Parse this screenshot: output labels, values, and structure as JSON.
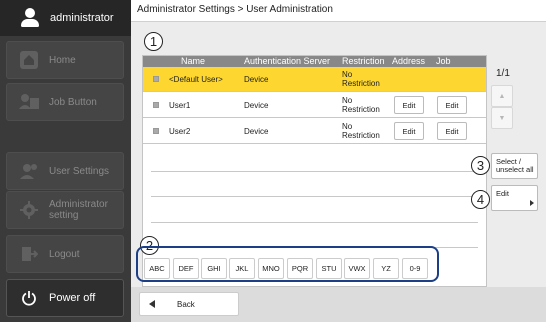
{
  "user": {
    "name": "administrator"
  },
  "sidebar": {
    "items": [
      {
        "label": "Home",
        "icon": "home-icon"
      },
      {
        "label": "Job Button",
        "icon": "job-button-icon"
      },
      {
        "label": "User Settings",
        "icon": "user-settings-icon"
      },
      {
        "label": "Administrator setting",
        "icon": "gear-icon"
      },
      {
        "label": "Logout",
        "icon": "logout-icon"
      }
    ],
    "power": {
      "label": "Power off",
      "icon": "power-icon"
    }
  },
  "header": {
    "breadcrumb": "Administrator Settings > User Administration"
  },
  "table": {
    "columns": [
      "Name",
      "Authentication Server",
      "Restriction",
      "Address",
      "Job"
    ],
    "rows": [
      {
        "name": "<Default User>",
        "server": "Device",
        "restriction": [
          "No",
          "Restriction"
        ],
        "address": "",
        "job": "",
        "selected": true
      },
      {
        "name": "User1",
        "server": "Device",
        "restriction": [
          "No",
          "Restriction"
        ],
        "address": "Edit",
        "job": "Edit",
        "selected": false
      },
      {
        "name": "User2",
        "server": "Device",
        "restriction": [
          "No",
          "Restriction"
        ],
        "address": "Edit",
        "job": "Edit",
        "selected": false
      }
    ]
  },
  "pager": {
    "text": "1/1",
    "up_icon": "triangle-up-icon",
    "down_icon": "triangle-down-icon"
  },
  "actions": {
    "select_all": [
      "Select /",
      "unselect all"
    ],
    "edit": "Edit"
  },
  "callouts": [
    "1",
    "2",
    "3",
    "4"
  ],
  "letters": [
    "ABC",
    "DEF",
    "GHI",
    "JKL",
    "MNO",
    "PQR",
    "STU",
    "VWX",
    "YZ",
    "0-9"
  ],
  "footer": {
    "back_label": "Back"
  },
  "colors": {
    "highlight": "#fdd72f",
    "callout_frame": "#1c3f86",
    "sidebar": "#3a3a3a"
  }
}
